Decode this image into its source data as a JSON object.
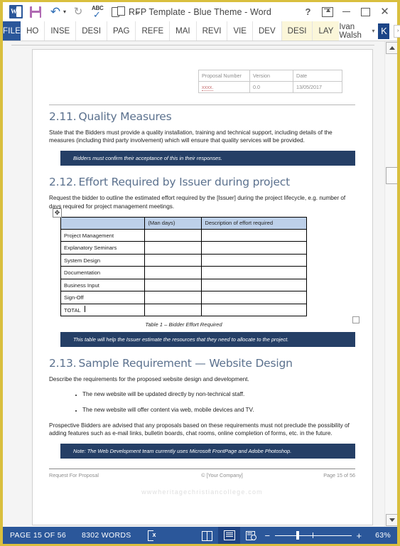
{
  "titlebar": {
    "app_icon": "word-logo-icon",
    "quick_access": [
      {
        "name": "save-icon",
        "label": "Save"
      },
      {
        "name": "undo-icon",
        "label": "Undo"
      },
      {
        "name": "undo-dropdown-icon",
        "label": "▾"
      },
      {
        "name": "redo-icon",
        "label": "Redo"
      },
      {
        "name": "spelling-check-icon",
        "label": "ABC"
      },
      {
        "name": "touch-mode-icon",
        "label": "Touch/Mouse Mode"
      },
      {
        "name": "customize-qat-icon",
        "label": "⌄"
      }
    ],
    "title": "RFP Template - Blue Theme - Word",
    "window_buttons": [
      {
        "name": "help-button",
        "label": "?"
      },
      {
        "name": "ribbon-display-options-button",
        "label": "Ribbon Display Options"
      },
      {
        "name": "minimize-button",
        "label": "Minimize"
      },
      {
        "name": "restore-button",
        "label": "Restore Down"
      },
      {
        "name": "close-button",
        "label": "✕"
      }
    ]
  },
  "ribbon": {
    "tabs": [
      {
        "label": "FILE",
        "type": "file"
      },
      {
        "label": "HO",
        "type": "normal"
      },
      {
        "label": "INSE",
        "type": "normal"
      },
      {
        "label": "DESI",
        "type": "normal"
      },
      {
        "label": "PAG",
        "type": "normal"
      },
      {
        "label": "REFE",
        "type": "normal"
      },
      {
        "label": "MAI",
        "type": "normal"
      },
      {
        "label": "REVI",
        "type": "normal"
      },
      {
        "label": "VIE",
        "type": "normal"
      },
      {
        "label": "DEV",
        "type": "normal"
      },
      {
        "label": "DESI",
        "type": "contextual"
      },
      {
        "label": "LAY",
        "type": "contextual"
      }
    ],
    "user_name": "Ivan Walsh",
    "user_chevron": "▾",
    "avatar_initial": "K",
    "ribbon_expand_chevron": "›"
  },
  "document": {
    "header_table": {
      "headers": [
        "Proposal Number",
        "Version",
        "Date"
      ],
      "values": [
        "xxxx.",
        "0.0",
        "13/05/2017"
      ]
    },
    "sections": [
      {
        "number": "2.11.",
        "title": "Quality Measures",
        "body": "State that the Bidders must provide a quality installation, training and technical support, including details of the measures (including third party involvement) which will ensure that quality services will be provided.",
        "callout": "Bidders must confirm their acceptance of this in their responses."
      },
      {
        "number": "2.12.",
        "title": "Effort Required by Issuer during project",
        "body": "Request the bidder to outline the estimated effort required by the [Issuer] during the project lifecycle, e.g. number of days required for project management meetings.",
        "callout": "This table will help the Issuer estimate the resources that they need to allocate to the project."
      },
      {
        "number": "2.13.",
        "title": "Sample Requirement — Website Design",
        "body": "Describe the requirements for the proposed website design and development.",
        "bullets": [
          "The new website will be updated directly by non-technical staff.",
          "The new website will offer content via web, mobile devices and TV."
        ],
        "body2": "Prospective Bidders are advised that any proposals based on these requirements must not preclude the possibility of adding features such as e-mail links, bulletin boards, chat rooms, online completion of forms, etc. in the future.",
        "callout": "Note: The Web Development team currently uses Microsoft FrontPage and Adobe Photoshop."
      }
    ],
    "effort_table": {
      "headers": [
        "",
        "(Man days)",
        "Description of effort required"
      ],
      "rows": [
        [
          "Project Management",
          "",
          ""
        ],
        [
          "Explanatory Seminars",
          "",
          ""
        ],
        [
          "System Design",
          "",
          ""
        ],
        [
          "Documentation",
          "",
          ""
        ],
        [
          "Business Input",
          "",
          ""
        ],
        [
          "Sign-Off",
          "",
          ""
        ],
        [
          "TOTAL",
          "",
          ""
        ]
      ],
      "caption": "Table 1 – Bidder Effort Required",
      "move_handle_icon": "move-handle-icon",
      "resize_handle_icon": "resize-handle-icon"
    },
    "footer": {
      "left": "Request For Proposal",
      "center": "© [Your Company]",
      "right": "Page 15 of 56"
    },
    "watermark": "wwwheritagechristiancollege.com"
  },
  "scrollbar": {
    "up_arrow": "scroll-up-icon",
    "down_arrow": "scroll-down-icon"
  },
  "statusbar": {
    "page_info": "PAGE 15 OF 56",
    "word_count": "8302 WORDS",
    "proofing_icon": "proofing-errors-icon",
    "views": [
      {
        "name": "read-mode-icon",
        "active": false
      },
      {
        "name": "print-layout-icon",
        "active": true
      },
      {
        "name": "web-layout-icon",
        "active": false
      }
    ],
    "zoom_out": "−",
    "zoom_in": "+",
    "zoom_level": "63%"
  },
  "colors": {
    "accent": "#2b579a",
    "window_border": "#d9bf3e",
    "callout_bg": "#253f66",
    "heading": "#5b718e",
    "table_header": "#bdd0e9",
    "contextual_tab": "#fbf6d9"
  }
}
